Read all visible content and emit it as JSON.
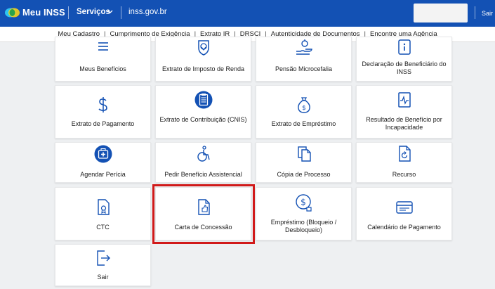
{
  "header": {
    "brand": "Meu INSS",
    "services_menu": "Serviços",
    "domain": "inss.gov.br",
    "exit_label": "Sair"
  },
  "subnav": {
    "items": [
      "Meu Cadastro",
      "Cumprimento de Exigência",
      "Extrato IR",
      "DRSCI",
      "Autenticidade de Documentos",
      "Encontre uma Agência"
    ],
    "separator": "|"
  },
  "cards": [
    {
      "label": "Meus Benefícios",
      "icon": "list-icon"
    },
    {
      "label": "Extrato de Imposto de Renda",
      "icon": "lion-shield-icon"
    },
    {
      "label": "Pensão Microcefalia",
      "icon": "hand-care-icon"
    },
    {
      "label": "Declaração de Beneficiário do INSS",
      "icon": "info-document-icon"
    },
    {
      "label": "Extrato de Pagamento",
      "icon": "dollar-icon"
    },
    {
      "label": "Extrato de Contribuição (CNIS)",
      "icon": "clipboard-icon"
    },
    {
      "label": "Extrato de Empréstimo",
      "icon": "money-bag-icon"
    },
    {
      "label": "Resultado de Benefício por Incapacidade",
      "icon": "pulse-document-icon"
    },
    {
      "label": "Agendar Perícia",
      "icon": "medical-kit-icon"
    },
    {
      "label": "Pedir Benefício Assistencial",
      "icon": "wheelchair-icon"
    },
    {
      "label": "Cópia de Processo",
      "icon": "copy-icon"
    },
    {
      "label": "Recurso",
      "icon": "refresh-document-icon"
    },
    {
      "label": "CTC",
      "icon": "certificate-icon"
    },
    {
      "label": "Carta de Concessão",
      "icon": "thumbs-up-document-icon"
    },
    {
      "label": "Empréstimo (Bloqueio / Desbloqueio)",
      "icon": "money-lock-icon"
    },
    {
      "label": "Calendário de Pagamento",
      "icon": "calendar-card-icon"
    },
    {
      "label": "Sair",
      "icon": "logout-icon"
    }
  ],
  "highlighted_card": "Carta de Concessão",
  "colors": {
    "header_bg": "#1351b4",
    "highlight_border": "#d11a1a",
    "icon_blue": "#1351b4",
    "page_bg": "#eef0f2"
  }
}
